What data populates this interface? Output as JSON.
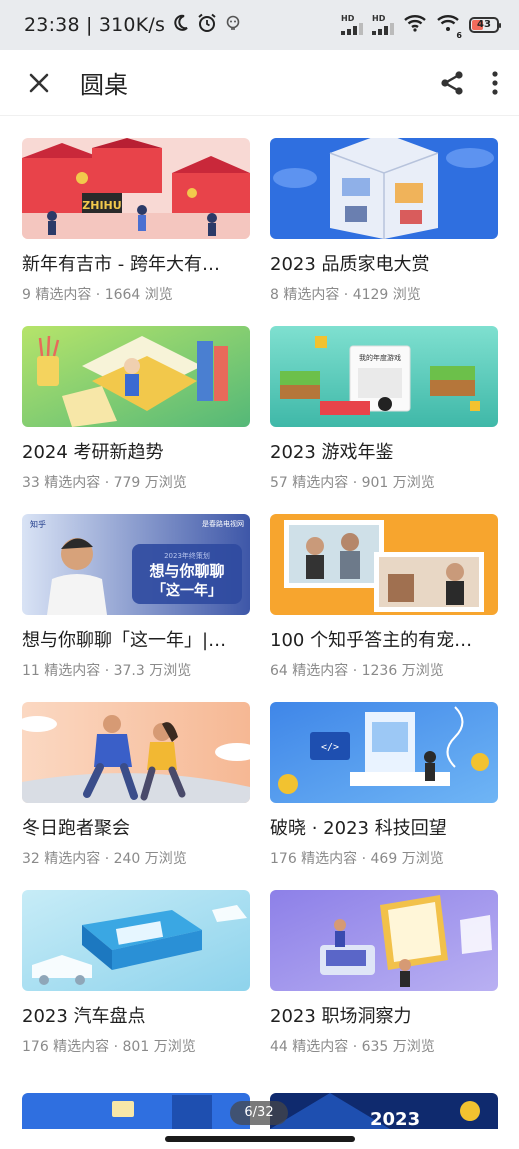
{
  "status": {
    "time_speed": "23:38 | 310K/s",
    "battery": "43",
    "wifi_label": "6",
    "icons": [
      "moon-icon",
      "alarm-icon",
      "notification-icon",
      "hd-signal-icon",
      "hd-signal-icon",
      "wifi-icon",
      "wifi-6-icon",
      "battery-icon"
    ]
  },
  "header": {
    "title": "圆桌",
    "icons": [
      "close-icon",
      "share-icon",
      "more-vertical-icon"
    ]
  },
  "cards": [
    {
      "title": "新年有吉市 - 跨年大有…",
      "meta": "9 精选内容 · 1664 浏览"
    },
    {
      "title": "2023 品质家电大赏",
      "meta": "8 精选内容 · 4129 浏览"
    },
    {
      "title": "2024 考研新趋势",
      "meta": "33 精选内容 · 779 万浏览"
    },
    {
      "title": "2023 游戏年鉴",
      "meta": "57 精选内容 · 901 万浏览"
    },
    {
      "title": "想与你聊聊「这一年」|…",
      "meta": "11 精选内容 · 37.3 万浏览"
    },
    {
      "title": "100 个知乎答主的有宠…",
      "meta": "64 精选内容 · 1236 万浏览"
    },
    {
      "title": "冬日跑者聚会",
      "meta": "32 精选内容 · 240 万浏览"
    },
    {
      "title": "破晓 · 2023 科技回望",
      "meta": "176 精选内容 · 469 万浏览"
    },
    {
      "title": "2023 汽车盘点",
      "meta": "176 精选内容 · 801 万浏览"
    },
    {
      "title": "2023 职场洞察力",
      "meta": "44 精选内容 · 635 万浏览"
    }
  ],
  "thumb_text": {
    "market_sign": "ZHIHU",
    "chat_zhihu": "知乎",
    "chat_brand": "是春路电视网",
    "chat_sub": "2023年终策划",
    "chat_line1": "想与你聊聊",
    "chat_line2": "「这一年」",
    "game_book": "我的年度游戏",
    "tech_code": "</>"
  },
  "partial_text": {
    "right_badge": "2023"
  },
  "pager": {
    "label": "6/32"
  },
  "colors": {
    "statusbar_bg": "#e9ebee",
    "battery_fill": "#f26b5b",
    "meta_text": "#8a8a8a",
    "title_text": "#1f1f1f"
  }
}
